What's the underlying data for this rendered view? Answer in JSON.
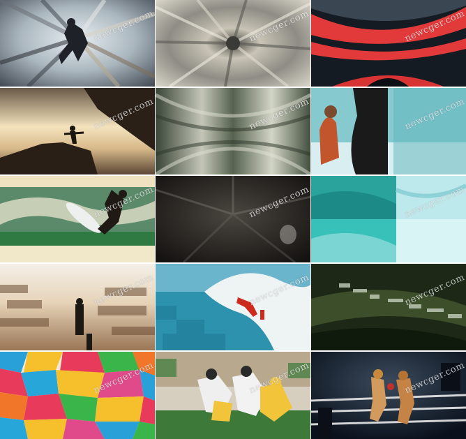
{
  "gallery": {
    "watermark": "newcger.com",
    "tiles": [
      {
        "subject": "skydiver radial zoom blur",
        "colors": [
          "#c9d4da",
          "#2a2f35",
          "#8f9aa3"
        ]
      },
      {
        "subject": "radial zoom burst",
        "colors": [
          "#8a8a82",
          "#e6e2d6",
          "#3a3a36"
        ]
      },
      {
        "subject": "red and black speed tunnel",
        "colors": [
          "#e23a3a",
          "#141a20",
          "#3a4550"
        ]
      },
      {
        "subject": "silhouette yoga on rocks at sunset",
        "colors": [
          "#f2d9a6",
          "#2e2218",
          "#6e5a45"
        ]
      },
      {
        "subject": "green streak blur",
        "colors": [
          "#6c7868",
          "#d4d6c8",
          "#2f3a30"
        ]
      },
      {
        "subject": "man at ocean with rock",
        "colors": [
          "#7fc8cf",
          "#c0502a",
          "#1c1c1c"
        ]
      },
      {
        "subject": "surfer on wave",
        "colors": [
          "#2f7a4a",
          "#f0e6c8",
          "#1a1a14"
        ]
      },
      {
        "subject": "dark textured blur",
        "colors": [
          "#3a3834",
          "#15130f",
          "#9a9890"
        ]
      },
      {
        "subject": "turquoise water split",
        "colors": [
          "#1fb3a8",
          "#bfe9ec",
          "#0f6f6a"
        ]
      },
      {
        "subject": "man on desert dunes",
        "colors": [
          "#e8d9c6",
          "#8a6a4c",
          "#1e1a16"
        ]
      },
      {
        "subject": "kayaker in big wave",
        "colors": [
          "#2d93b0",
          "#f2f4f4",
          "#cc2a1c"
        ]
      },
      {
        "subject": "green forest tunnel",
        "colors": [
          "#1e2a16",
          "#5a6a3a",
          "#c9d4c0"
        ]
      },
      {
        "subject": "colorful umbrellas",
        "colors": [
          "#e83a5a",
          "#27a7d9",
          "#f5c02c"
        ]
      },
      {
        "subject": "american football players",
        "colors": [
          "#3a7a3a",
          "#f2c43a",
          "#efefef"
        ]
      },
      {
        "subject": "boxers in ring",
        "colors": [
          "#0f1a2a",
          "#f2f2f2",
          "#c8893a"
        ]
      }
    ]
  }
}
